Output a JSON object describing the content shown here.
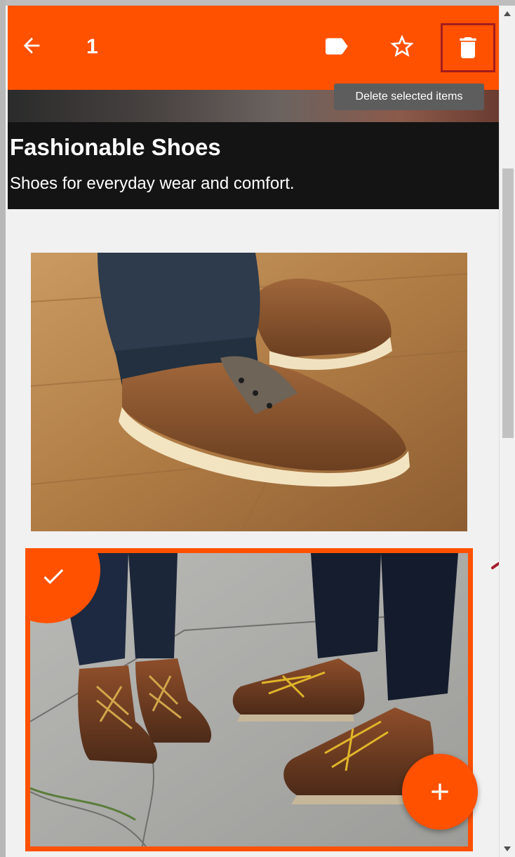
{
  "appbar": {
    "selected_count": "1",
    "icons": {
      "back": "arrow-back-icon",
      "label": "label-icon",
      "star": "star-outline-icon",
      "delete": "delete-icon"
    },
    "background_color": "#ff5100"
  },
  "tooltip": {
    "text": "Delete selected items"
  },
  "hero": {
    "title": "Fashionable Shoes",
    "subtitle": "Shoes for everyday wear and comfort."
  },
  "cards": [
    {
      "image": "brown-boat-shoes-photo",
      "selected": false
    },
    {
      "image": "leather-hiking-boots-photo",
      "selected": true,
      "badge_icon": "check-icon"
    }
  ],
  "fab": {
    "icon": "plus-icon"
  },
  "colors": {
    "accent": "#ff5100",
    "hero_background": "#141414",
    "tooltip_background": "#5d5d5d",
    "delete_highlight": "#a31d1d"
  }
}
